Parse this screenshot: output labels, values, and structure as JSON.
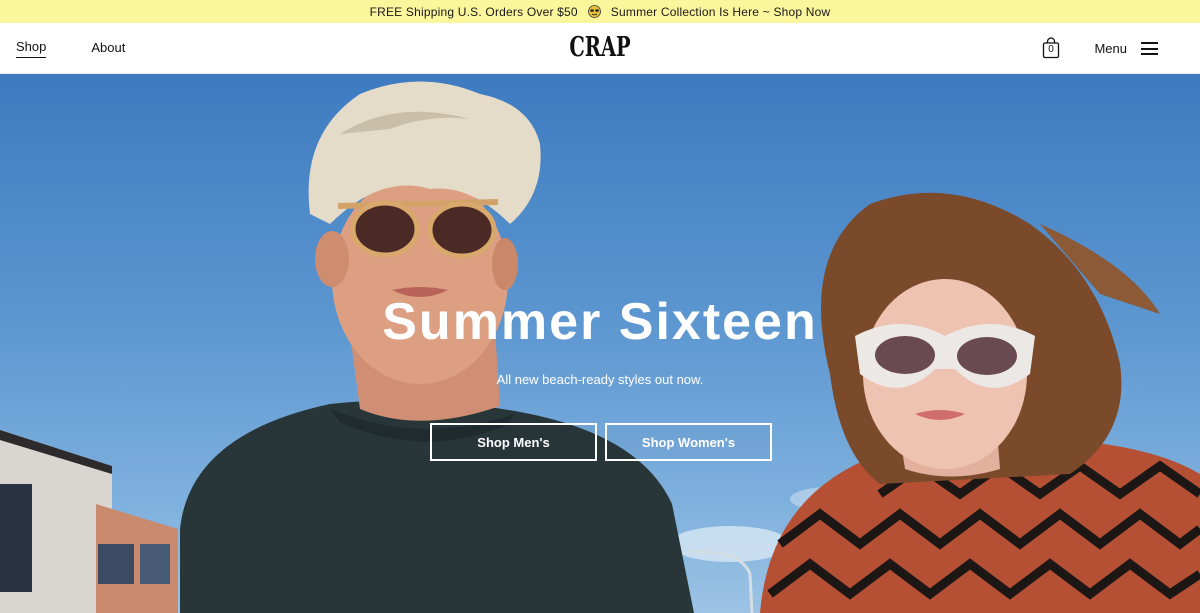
{
  "announcement": {
    "left_text": "FREE Shipping U.S. Orders Over $50",
    "separator_icon": "sunglasses-emoji-icon",
    "right_text": "Summer Collection Is Here ~ Shop Now"
  },
  "header": {
    "nav": [
      {
        "label": "Shop",
        "active": true
      },
      {
        "label": "About",
        "active": false
      }
    ],
    "logo": "CRAP",
    "cart_count": "0",
    "cart_icon": "shopping-bag-icon",
    "menu_label": "Menu",
    "menu_icon": "hamburger-icon"
  },
  "hero": {
    "title": "Summer Sixteen",
    "subtitle": "All new beach-ready styles out now.",
    "buttons": [
      {
        "label": "Shop Men's"
      },
      {
        "label": "Shop Women's"
      }
    ]
  },
  "colors": {
    "announcement_bg": "#fbf59b",
    "sky": "#5c96d0",
    "text_dark": "#111111",
    "white": "#ffffff"
  }
}
